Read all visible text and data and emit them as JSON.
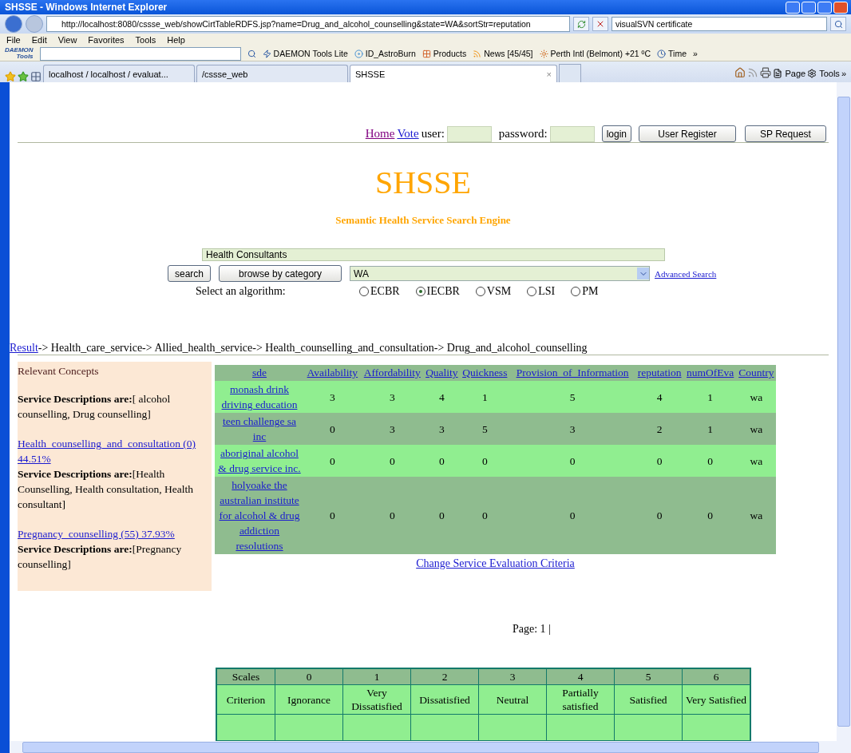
{
  "window": {
    "title": "SHSSE - Windows Internet Explorer"
  },
  "address_bar": {
    "url": "http://localhost:8080/cssse_web/showCirtTableRDFS.jsp?name=Drug_and_alcohol_counselling&state=WA&sortStr=reputation",
    "search_value": "visualSVN certificate"
  },
  "menu": [
    "File",
    "Edit",
    "View",
    "Favorites",
    "Tools",
    "Help"
  ],
  "toolbar": {
    "logo": [
      "DAEMON",
      "Tools"
    ],
    "items": [
      "DAEMON Tools Lite",
      "ID_AstroBurn",
      "Products",
      "News [45/45]",
      "Perth Intl (Belmont) +21 ºC",
      "Time"
    ],
    "more": "»"
  },
  "tabs": [
    {
      "label": "localhost / localhost / evaluat...",
      "selected": false
    },
    {
      "label": "/cssse_web",
      "selected": false
    },
    {
      "label": "SHSSE",
      "selected": true
    }
  ],
  "tab_close": "×",
  "command_bar": {
    "items": [
      "Page",
      "Tools"
    ],
    "more": "»"
  },
  "page": {
    "nav_links": [
      "Home",
      "Vote"
    ],
    "user_label": "user:",
    "password_label": "password:",
    "buttons": [
      "login",
      "User Register",
      "SP Request"
    ],
    "title": "SHSSE",
    "subtitle": "Semantic Health Service Search Engine",
    "search_value": "Health Consultants",
    "search_button": "search",
    "browse_button": "browse by category",
    "state_value": "WA",
    "advanced_link": "Advanced Search",
    "algorithm_label": "Select an algorithm:",
    "algorithms": [
      {
        "label": "ECBR",
        "selected": false
      },
      {
        "label": "IECBR",
        "selected": true
      },
      {
        "label": "VSM",
        "selected": false
      },
      {
        "label": "LSI",
        "selected": false
      },
      {
        "label": "PM",
        "selected": false
      }
    ],
    "breadcrumb": {
      "link": "Result",
      "rest": "-> Health_care_service-> Allied_health_service-> Health_counselling_and_consultation-> Drug_and_alcohol_counselling"
    },
    "concepts": {
      "heading": "Relevant Concepts",
      "items": [
        {
          "descriptions": "**Service Descriptions are:**[ alcohol counselling, Drug counselling]"
        },
        {
          "link": "Health_counselling_and_consultation (0) 44.51%",
          "descriptions": "**Service Descriptions are:**[Health Counselling, Health consultation, Health consultant]"
        },
        {
          "link": "Pregnancy_counselling (55) 37.93%",
          "descriptions": "**Service Descriptions are:**[Pregnancy counselling]"
        }
      ]
    },
    "results": {
      "columns": [
        "sde",
        "Availability",
        "Affordability",
        "Quality",
        "Quickness",
        "Provision_of_Information",
        "reputation",
        "numOfEva",
        "Country"
      ],
      "rows": [
        {
          "name": "monash drink driving education",
          "values": [
            "3",
            "3",
            "4",
            "1",
            "5",
            "4",
            "1"
          ],
          "country": "wa"
        },
        {
          "name": "teen challenge sa inc",
          "values": [
            "0",
            "3",
            "3",
            "5",
            "3",
            "2",
            "1"
          ],
          "country": "wa"
        },
        {
          "name": "aboriginal alcohol & drug service inc.",
          "values": [
            "0",
            "0",
            "0",
            "0",
            "0",
            "0",
            "0"
          ],
          "country": "wa"
        },
        {
          "name": "holyoake the australian institute for alcohol & drug addiction resolutions",
          "values": [
            "0",
            "0",
            "0",
            "0",
            "0",
            "0",
            "0"
          ],
          "country": "wa"
        }
      ]
    },
    "change_link": "Change Service Evaluation Criteria",
    "pagination": "Page: 1 |",
    "scales": {
      "header": [
        "Scales",
        "0",
        "1",
        "2",
        "3",
        "4",
        "5",
        "6"
      ],
      "rows": [
        [
          "Criterion",
          "Ignorance",
          "Very Dissatisfied",
          "Dissatisfied",
          "Neutral",
          "Partially satisfied",
          "Satisfied",
          "Very Satisfied"
        ]
      ]
    }
  }
}
